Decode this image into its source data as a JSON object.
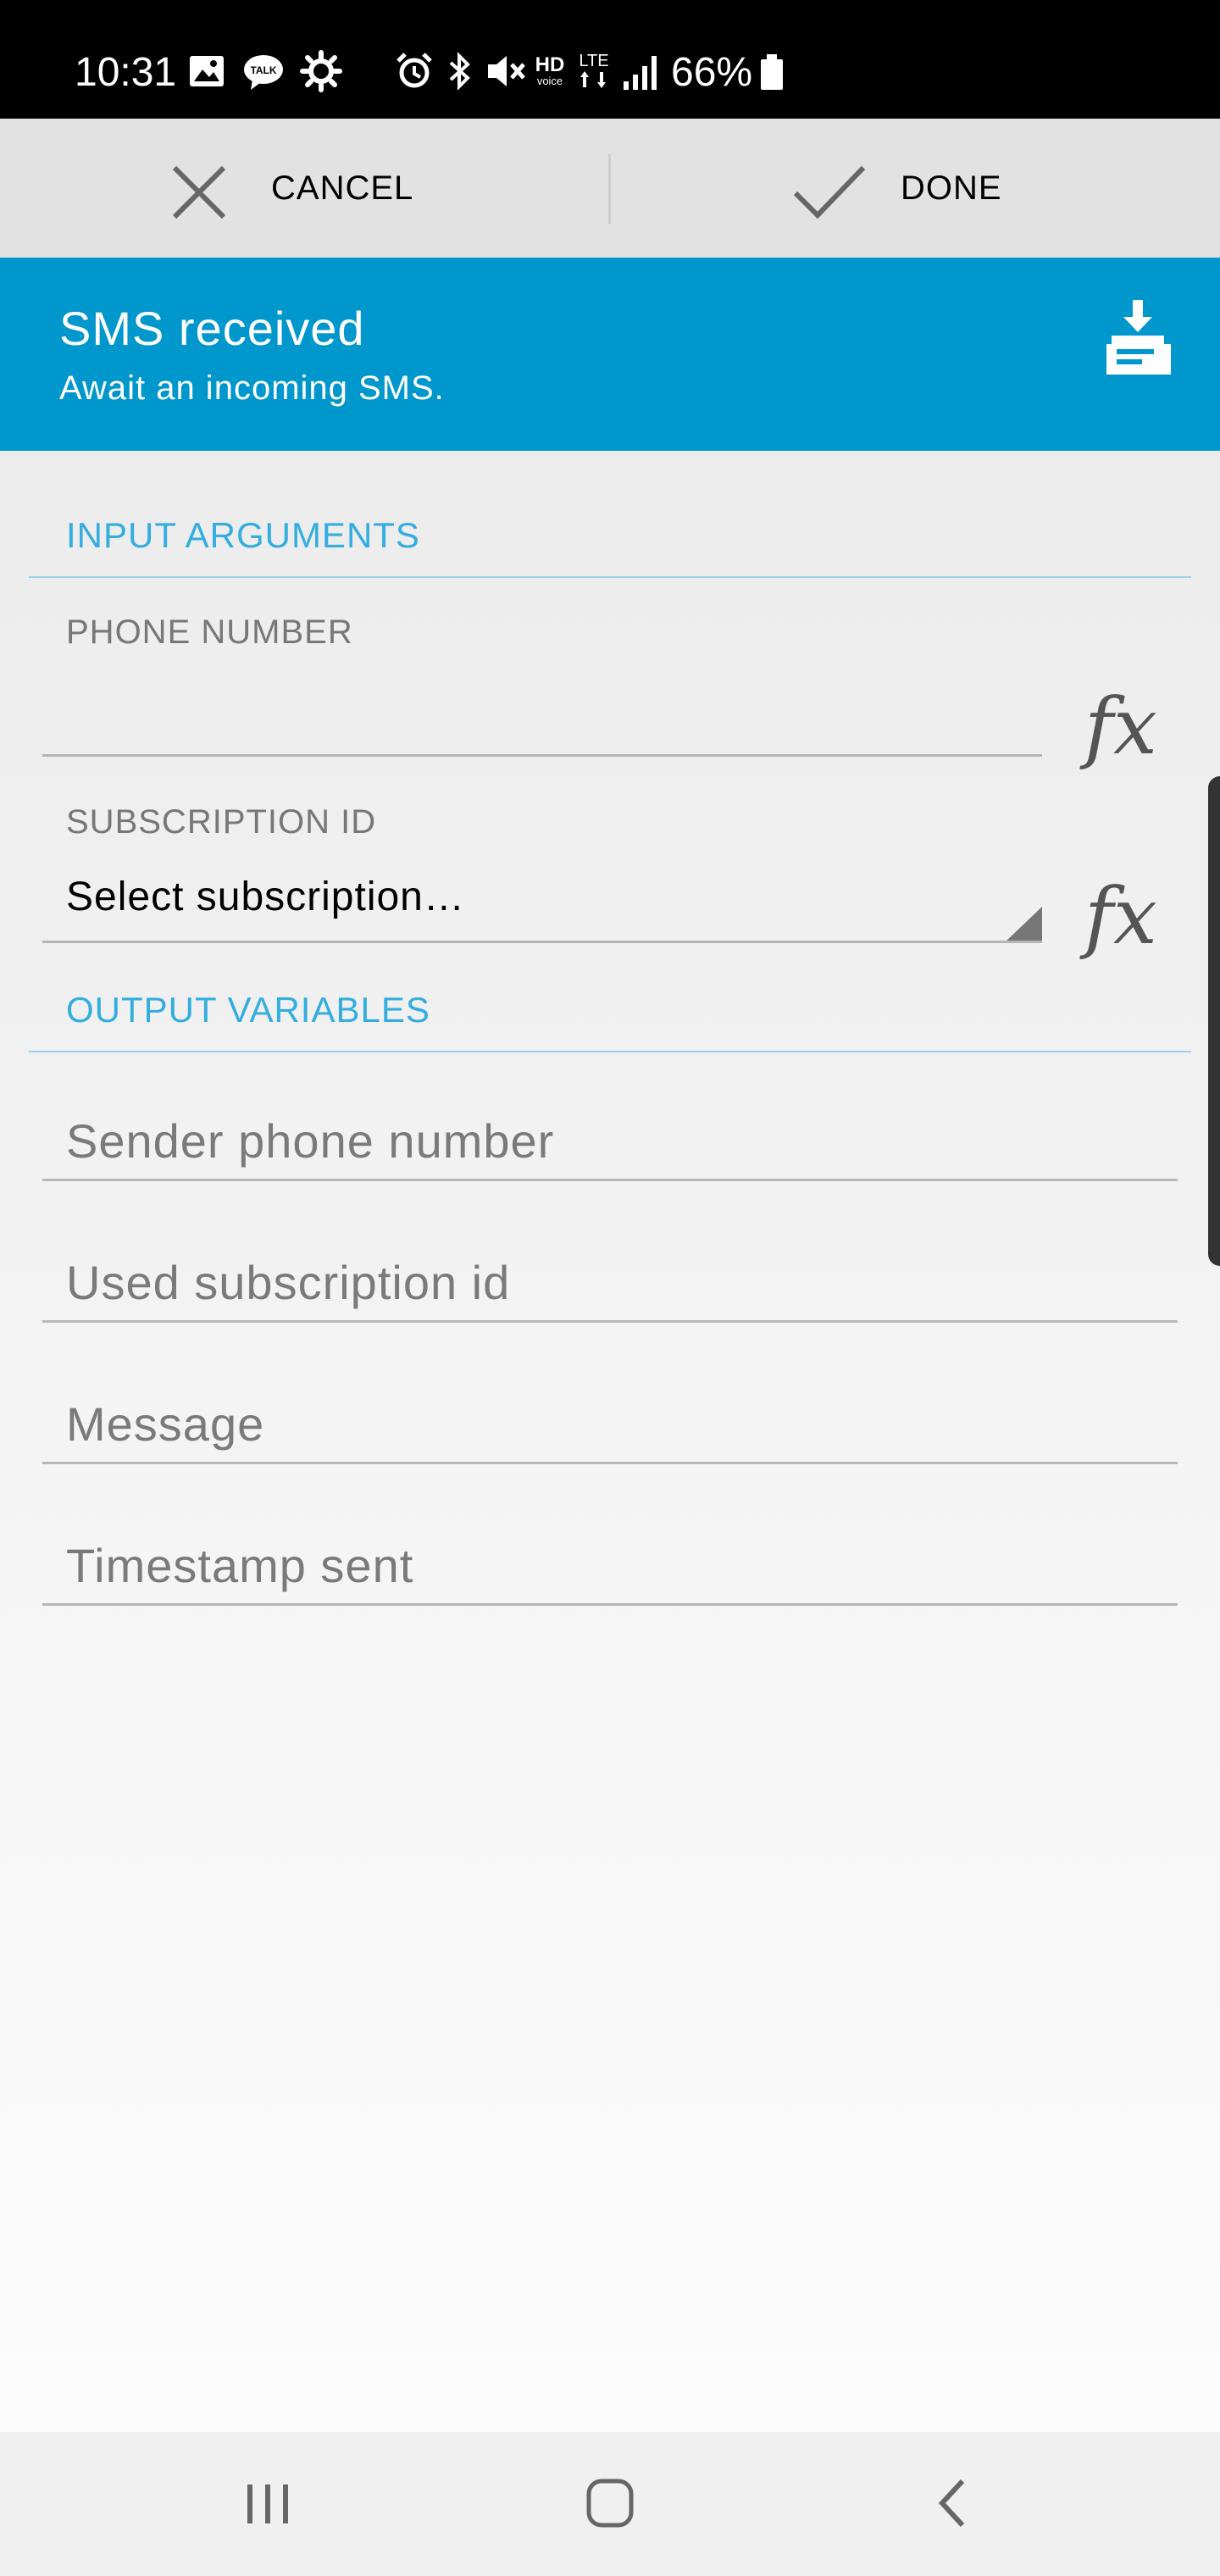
{
  "status_bar": {
    "time": "10:31",
    "battery_percent": "66%",
    "icons": [
      "gallery-icon",
      "talk-icon",
      "gear-icon",
      "alarm-icon",
      "bluetooth-icon",
      "mute-icon",
      "hd-voice-icon",
      "lte-icon",
      "signal-icon",
      "battery-icon"
    ]
  },
  "action_bar": {
    "cancel_label": "CANCEL",
    "done_label": "DONE"
  },
  "header": {
    "title": "SMS received",
    "subtitle": "Await an incoming SMS.",
    "icon": "import-icon",
    "background_color": "#0097cc"
  },
  "input_arguments": {
    "section_title": "INPUT ARGUMENTS",
    "phone_number": {
      "label": "PHONE NUMBER",
      "value": "",
      "fx_label": "fx"
    },
    "subscription_id": {
      "label": "SUBSCRIPTION ID",
      "selected_value": "Select subscription…",
      "fx_label": "fx"
    }
  },
  "output_variables": {
    "section_title": "OUTPUT VARIABLES",
    "fields": [
      {
        "placeholder": "Sender phone number",
        "value": ""
      },
      {
        "placeholder": "Used subscription id",
        "value": ""
      },
      {
        "placeholder": "Message",
        "value": ""
      },
      {
        "placeholder": "Timestamp sent",
        "value": ""
      }
    ]
  },
  "nav_bar": {
    "buttons": [
      "recents-icon",
      "home-icon",
      "back-icon"
    ]
  },
  "colors": {
    "accent": "#34ade0",
    "header": "#0097cc",
    "action_bar": "#e2e2e2"
  }
}
